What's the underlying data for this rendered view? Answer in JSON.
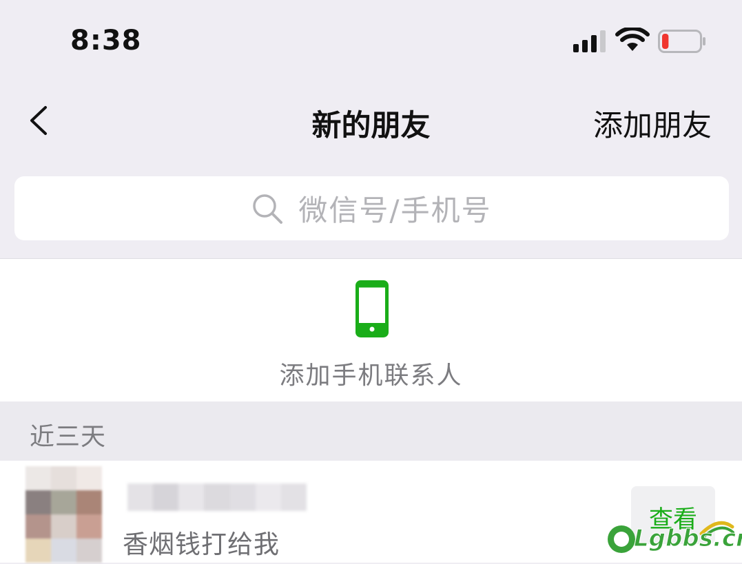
{
  "status_bar": {
    "time": "8:38",
    "signal_icon": "cellular-signal-icon",
    "wifi_icon": "wifi-icon",
    "battery_icon": "battery-low-icon",
    "battery_level": 0.12,
    "battery_color": "#f0362f"
  },
  "nav": {
    "back_icon": "chevron-left-icon",
    "title": "新的朋友",
    "add_friend": "添加朋友"
  },
  "search": {
    "icon": "search-icon",
    "placeholder": "微信号/手机号"
  },
  "phone_contacts": {
    "icon": "smartphone-icon",
    "label": "添加手机联系人",
    "icon_color": "#1aad19"
  },
  "section": {
    "title": "近三天"
  },
  "friends": [
    {
      "message": "香烟钱打给我",
      "action": "查看"
    }
  ],
  "watermark": {
    "text": "Lgbbs.cn"
  },
  "colors": {
    "accent": "#1aad19",
    "background": "#efedf3"
  }
}
